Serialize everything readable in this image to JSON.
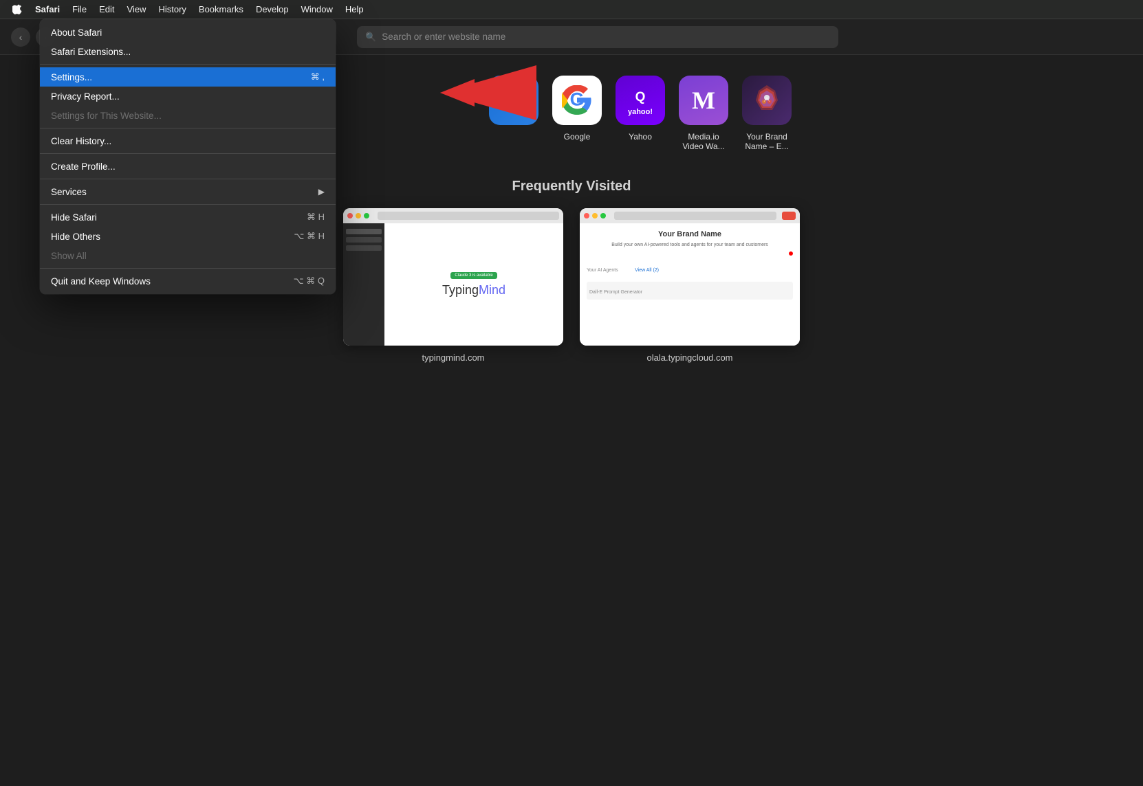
{
  "menubar": {
    "apple_label": "",
    "items": [
      {
        "id": "safari",
        "label": "Safari",
        "bold": true
      },
      {
        "id": "file",
        "label": "File"
      },
      {
        "id": "edit",
        "label": "Edit"
      },
      {
        "id": "view",
        "label": "View"
      },
      {
        "id": "history",
        "label": "History"
      },
      {
        "id": "bookmarks",
        "label": "Bookmarks"
      },
      {
        "id": "develop",
        "label": "Develop"
      },
      {
        "id": "window",
        "label": "Window"
      },
      {
        "id": "help",
        "label": "Help"
      }
    ]
  },
  "safari_menu": {
    "items": [
      {
        "id": "about",
        "label": "About Safari",
        "shortcut": "",
        "type": "normal"
      },
      {
        "id": "extensions",
        "label": "Safari Extensions...",
        "shortcut": "",
        "type": "normal"
      },
      {
        "id": "sep1",
        "type": "separator"
      },
      {
        "id": "settings",
        "label": "Settings...",
        "shortcut": "⌘ ,",
        "type": "highlighted"
      },
      {
        "id": "privacy",
        "label": "Privacy Report...",
        "shortcut": "",
        "type": "normal"
      },
      {
        "id": "website-settings",
        "label": "Settings for This Website...",
        "shortcut": "",
        "type": "disabled"
      },
      {
        "id": "sep2",
        "type": "separator"
      },
      {
        "id": "clear-history",
        "label": "Clear History...",
        "shortcut": "",
        "type": "normal"
      },
      {
        "id": "sep3",
        "type": "separator"
      },
      {
        "id": "create-profile",
        "label": "Create Profile...",
        "shortcut": "",
        "type": "normal"
      },
      {
        "id": "sep4",
        "type": "separator"
      },
      {
        "id": "services",
        "label": "Services",
        "shortcut": "▶",
        "type": "submenu"
      },
      {
        "id": "sep5",
        "type": "separator"
      },
      {
        "id": "hide-safari",
        "label": "Hide Safari",
        "shortcut": "⌘ H",
        "type": "normal"
      },
      {
        "id": "hide-others",
        "label": "Hide Others",
        "shortcut": "⌥ ⌘ H",
        "type": "normal"
      },
      {
        "id": "show-all",
        "label": "Show All",
        "shortcut": "",
        "type": "disabled"
      },
      {
        "id": "sep6",
        "type": "separator"
      },
      {
        "id": "quit",
        "label": "Quit and Keep Windows",
        "shortcut": "⌥ ⌘ Q",
        "type": "normal"
      }
    ]
  },
  "address_bar": {
    "placeholder": "Search or enter website name"
  },
  "favorites": {
    "items": [
      {
        "id": "google",
        "label": "Google"
      },
      {
        "id": "yahoo",
        "label": "Yahoo"
      },
      {
        "id": "mediaio",
        "label": "Media.io\nVideo Wa..."
      },
      {
        "id": "brand",
        "label": "Your Brand\nName – E..."
      }
    ]
  },
  "frequently_visited": {
    "title": "Frequently Visited",
    "items": [
      {
        "id": "typingmind",
        "label": "typingmind.com",
        "badge": "Claude 3 is available"
      },
      {
        "id": "olala",
        "label": "olala.typingcloud.com",
        "title": "Your Brand Name"
      }
    ]
  }
}
